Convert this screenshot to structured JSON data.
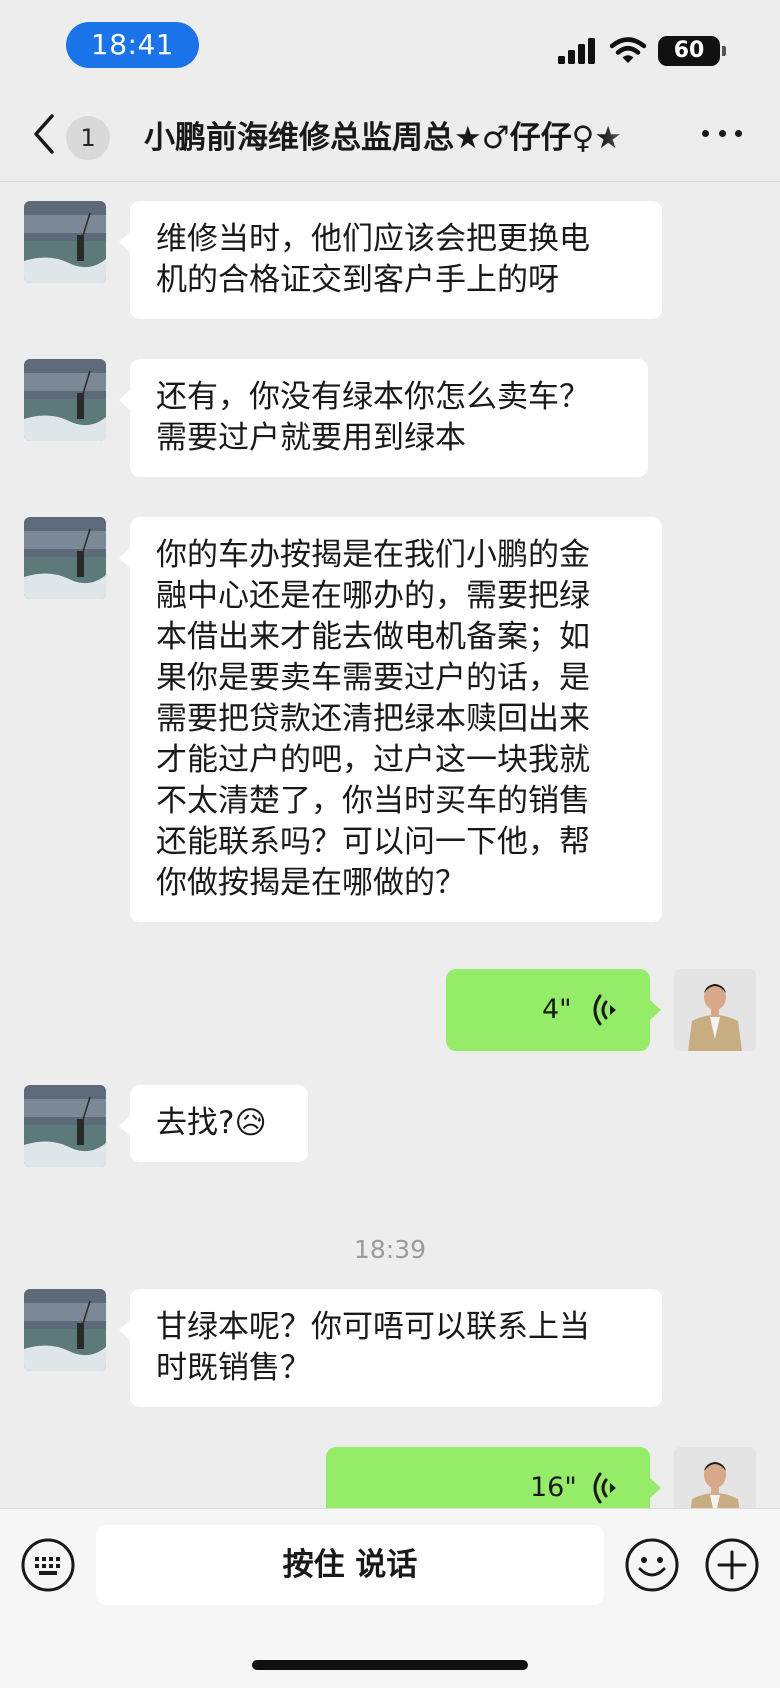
{
  "status_bar": {
    "time": "18:41",
    "battery": "60"
  },
  "header": {
    "back_count": "1",
    "title": "小鹏前海维修总监周总★♂仔仔♀★"
  },
  "messages": [
    {
      "side": "in",
      "text": "维修当时，他们应该会把更换电\n机的合格证交到客户手上的呀"
    },
    {
      "side": "in",
      "text": "还有，你没有绿本你怎么卖车？\n需要过户就要用到绿本"
    },
    {
      "side": "in",
      "text": "你的车办按揭是在我们小鹏的金\n融中心还是在哪办的，需要把绿\n本借出来才能去做电机备案；如\n果你是要卖车需要过户的话，是\n需要把贷款还清把绿本赎回出来\n才能过户的吧，过户这一块我就\n不太清楚了，你当时买车的销售\n还能联系吗？可以问一下他，帮\n你做按揭是在哪做的？"
    },
    {
      "side": "out",
      "type": "voice",
      "duration": "4\""
    },
    {
      "side": "in",
      "text": "去找?😥"
    },
    {
      "type": "timestamp",
      "text": "18:39"
    },
    {
      "side": "in",
      "text": "甘绿本呢？你可唔可以联系上当\n时既销售？"
    },
    {
      "side": "out",
      "type": "voice",
      "duration": "16\""
    }
  ],
  "input_bar": {
    "talk_label": "按住 说话"
  },
  "colors": {
    "sent_bubble": "#95ec69",
    "received_bubble": "#ffffff",
    "background": "#ededed",
    "time_pill": "#1a73e8"
  }
}
